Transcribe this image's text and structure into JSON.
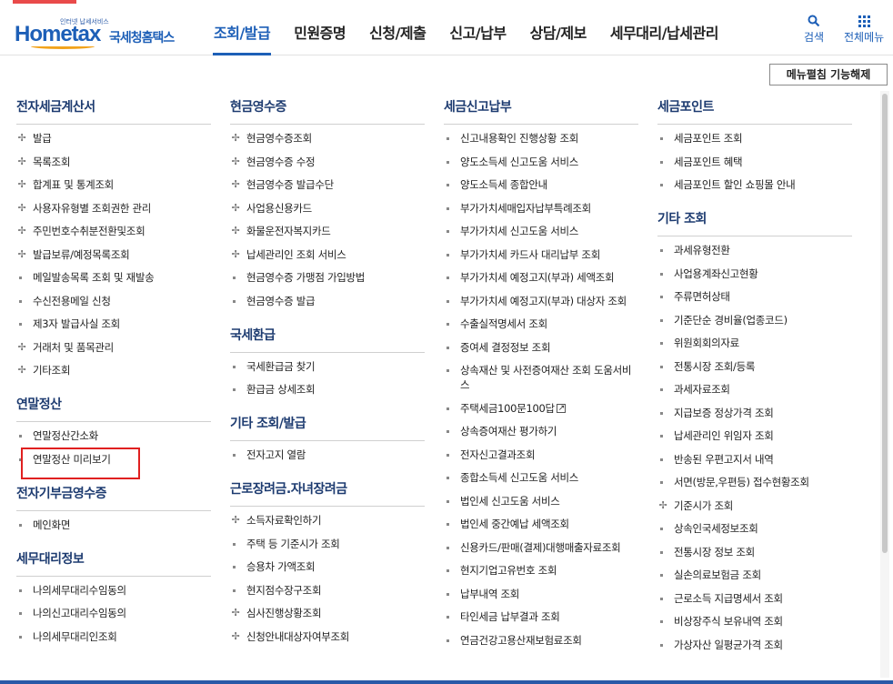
{
  "logo": {
    "small_text": "인터넷 납세서비스",
    "brand": "Hometax",
    "brand_ko": "국세청홈택스"
  },
  "gnb": [
    {
      "label": "조회/발급",
      "active": true
    },
    {
      "label": "민원증명",
      "active": false
    },
    {
      "label": "신청/제출",
      "active": false
    },
    {
      "label": "신고/납부",
      "active": false
    },
    {
      "label": "상담/제보",
      "active": false
    },
    {
      "label": "세무대리/납세관리",
      "active": false
    }
  ],
  "util": {
    "search_label": "검색",
    "search_icon": "search-icon",
    "menu_label": "전체메뉴",
    "menu_icon": "grid-icon"
  },
  "fold_button": "메뉴펼침 기능해제",
  "columns": [
    [
      {
        "title": "전자세금계산서",
        "items": [
          {
            "label": "발급",
            "bullet": "plus"
          },
          {
            "label": "목록조회",
            "bullet": "plus"
          },
          {
            "label": "합계표 및 통계조회",
            "bullet": "plus"
          },
          {
            "label": "사용자유형별 조회권한 관리",
            "bullet": "plus"
          },
          {
            "label": "주민번호수취분전환및조회",
            "bullet": "plus"
          },
          {
            "label": "발급보류/예정목록조회",
            "bullet": "plus"
          },
          {
            "label": "메일발송목록 조회 및 재발송",
            "bullet": "dot"
          },
          {
            "label": "수신전용메일 신청",
            "bullet": "dot"
          },
          {
            "label": "제3자 발급사실 조회",
            "bullet": "dot"
          },
          {
            "label": "거래처 및 품목관리",
            "bullet": "plus"
          },
          {
            "label": "기타조회",
            "bullet": "plus"
          }
        ]
      },
      {
        "title": "연말정산",
        "items": [
          {
            "label": "연말정산간소화",
            "bullet": "dot"
          },
          {
            "label": "연말정산 미리보기",
            "bullet": "dot"
          }
        ]
      },
      {
        "title": "전자기부금영수증",
        "items": [
          {
            "label": "메인화면",
            "bullet": "dot"
          }
        ]
      },
      {
        "title": "세무대리정보",
        "items": [
          {
            "label": "나의세무대리수임동의",
            "bullet": "dot"
          },
          {
            "label": "나의신고대리수임동의",
            "bullet": "dot"
          },
          {
            "label": "나의세무대리인조회",
            "bullet": "dot"
          }
        ]
      }
    ],
    [
      {
        "title": "현금영수증",
        "items": [
          {
            "label": "현금영수증조회",
            "bullet": "plus"
          },
          {
            "label": "현금영수증 수정",
            "bullet": "plus"
          },
          {
            "label": "현금영수증 발급수단",
            "bullet": "plus"
          },
          {
            "label": "사업용신용카드",
            "bullet": "plus"
          },
          {
            "label": "화물운전자복지카드",
            "bullet": "plus"
          },
          {
            "label": "납세관리인 조회 서비스",
            "bullet": "plus"
          },
          {
            "label": "현금영수증 가맹점 가입방법",
            "bullet": "dot"
          },
          {
            "label": "현금영수증 발급",
            "bullet": "dot"
          }
        ]
      },
      {
        "title": "국세환급",
        "items": [
          {
            "label": "국세환급금 찾기",
            "bullet": "dot"
          },
          {
            "label": "환급금 상세조회",
            "bullet": "dot"
          }
        ]
      },
      {
        "title": "기타 조회/발급",
        "items": [
          {
            "label": "전자고지 열람",
            "bullet": "dot"
          }
        ]
      },
      {
        "title": "근로장려금.자녀장려금",
        "items": [
          {
            "label": "소득자료확인하기",
            "bullet": "plus"
          },
          {
            "label": "주택 등 기준시가 조회",
            "bullet": "dot"
          },
          {
            "label": "승용차 가액조회",
            "bullet": "dot"
          },
          {
            "label": "현지점수장구조회",
            "bullet": "dot"
          },
          {
            "label": "심사진행상황조회",
            "bullet": "plus"
          },
          {
            "label": "신청안내대상자여부조회",
            "bullet": "plus"
          }
        ]
      }
    ],
    [
      {
        "title": "세금신고납부",
        "items": [
          {
            "label": "신고내용확인 진행상황 조회",
            "bullet": "dot"
          },
          {
            "label": "양도소득세 신고도움 서비스",
            "bullet": "dot"
          },
          {
            "label": "양도소득세 종합안내",
            "bullet": "dot"
          },
          {
            "label": "부가가치세매입자납부특례조회",
            "bullet": "dot"
          },
          {
            "label": "부가가치세 신고도움 서비스",
            "bullet": "dot"
          },
          {
            "label": "부가가치세 카드사 대리납부 조회",
            "bullet": "dot"
          },
          {
            "label": "부가가치세 예정고지(부과) 세액조회",
            "bullet": "dot"
          },
          {
            "label": "부가가치세 예정고지(부과) 대상자 조회",
            "bullet": "dot",
            "wrap": true
          },
          {
            "label": "수출실적명세서 조회",
            "bullet": "dot"
          },
          {
            "label": "증여세 결정정보 조회",
            "bullet": "dot"
          },
          {
            "label": "상속재산 및 사전증여재산 조회 도움서비스",
            "bullet": "dot",
            "wrap": true
          },
          {
            "label": "주택세금100문100답",
            "bullet": "dot",
            "external": true
          },
          {
            "label": "상속증여재산 평가하기",
            "bullet": "dot"
          },
          {
            "label": "전자신고결과조회",
            "bullet": "dot"
          },
          {
            "label": "종합소득세 신고도움 서비스",
            "bullet": "dot"
          },
          {
            "label": "법인세 신고도움 서비스",
            "bullet": "dot"
          },
          {
            "label": "법인세 중간예납 세액조회",
            "bullet": "dot"
          },
          {
            "label": "신용카드/판매(결제)대행매출자료조회",
            "bullet": "dot"
          },
          {
            "label": "현지기업고유번호 조회",
            "bullet": "dot"
          },
          {
            "label": "납부내역 조회",
            "bullet": "dot"
          },
          {
            "label": "타인세금 납부결과 조회",
            "bullet": "dot"
          },
          {
            "label": "연금건강고용산재보험료조회",
            "bullet": "dot"
          }
        ]
      }
    ],
    [
      {
        "title": "세금포인트",
        "items": [
          {
            "label": "세금포인트 조회",
            "bullet": "dot"
          },
          {
            "label": "세금포인트 혜택",
            "bullet": "dot"
          },
          {
            "label": "세금포인트 할인 쇼핑몰 안내",
            "bullet": "dot"
          }
        ]
      },
      {
        "title": "기타 조회",
        "items": [
          {
            "label": "과세유형전환",
            "bullet": "dot"
          },
          {
            "label": "사업용계좌신고현황",
            "bullet": "dot"
          },
          {
            "label": "주류면허상태",
            "bullet": "dot"
          },
          {
            "label": "기준단순 경비율(업종코드)",
            "bullet": "dot"
          },
          {
            "label": "위원회회의자료",
            "bullet": "dot"
          },
          {
            "label": "전통시장 조회/등록",
            "bullet": "dot"
          },
          {
            "label": "과세자료조회",
            "bullet": "dot"
          },
          {
            "label": "지급보증 정상가격 조회",
            "bullet": "dot"
          },
          {
            "label": "납세관리인 위임자 조회",
            "bullet": "dot"
          },
          {
            "label": "반송된 우편고지서 내역",
            "bullet": "dot"
          },
          {
            "label": "서면(방문,우편등) 접수현황조회",
            "bullet": "dot"
          },
          {
            "label": "기준시가 조회",
            "bullet": "plus"
          },
          {
            "label": "상속인국세정보조회",
            "bullet": "dot"
          },
          {
            "label": "전통시장 정보 조회",
            "bullet": "dot"
          },
          {
            "label": "실손의료보험금 조회",
            "bullet": "dot"
          },
          {
            "label": "근로소득 지급명세서 조회",
            "bullet": "dot"
          },
          {
            "label": "비상장주식 보유내역 조회",
            "bullet": "dot"
          },
          {
            "label": "가상자산 일평균가격 조회",
            "bullet": "dot"
          }
        ]
      }
    ]
  ]
}
